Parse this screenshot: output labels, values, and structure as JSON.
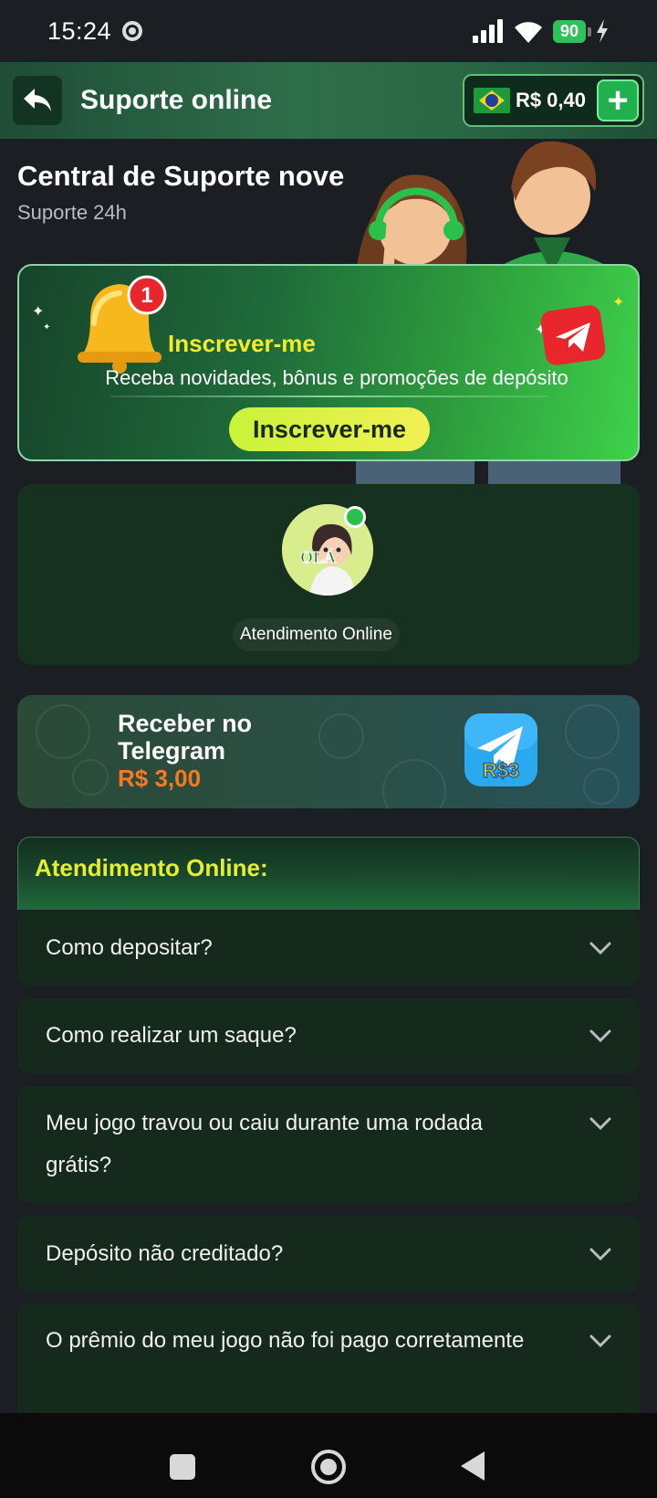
{
  "status_bar": {
    "time": "15:24",
    "battery": "90",
    "icons": [
      "chrome-icon",
      "signal-icon",
      "wifi-icon",
      "battery-icon",
      "charging-icon"
    ]
  },
  "header": {
    "title": "Suporte online",
    "balance": "R$ 0,40",
    "flag": "brazil-flag-icon",
    "add_label": "+"
  },
  "hero": {
    "title": "Central de Suporte nove",
    "subtitle": "Suporte 24h"
  },
  "subscribe_banner": {
    "title": "Inscrever-me",
    "description": "Receba novidades, bônus e promoções de depósito",
    "button_label": "Inscrever-me",
    "badge_count": "1"
  },
  "agent_card": {
    "avatar_text": "OLÁ",
    "label": "Atendimento Online",
    "online": true
  },
  "telegram_banner": {
    "title": "Receber no Telegram",
    "amount": "R$ 3,00",
    "icon_text": "R$3"
  },
  "faq": {
    "header": "Atendimento Online:",
    "items": [
      {
        "question": "Como depositar?"
      },
      {
        "question": "Como realizar um saque?"
      },
      {
        "question": "Meu jogo travou ou caiu durante uma rodada grátis?"
      },
      {
        "question": "Depósito não creditado?"
      },
      {
        "question": "O prêmio do meu jogo não foi pago corretamente"
      }
    ]
  },
  "colors": {
    "background": "#1b1e22",
    "header_green": "#2f6e4b",
    "accent_yellow": "#e5ef2e",
    "amount_orange": "#f57a1f",
    "card_green": "#15291c"
  }
}
